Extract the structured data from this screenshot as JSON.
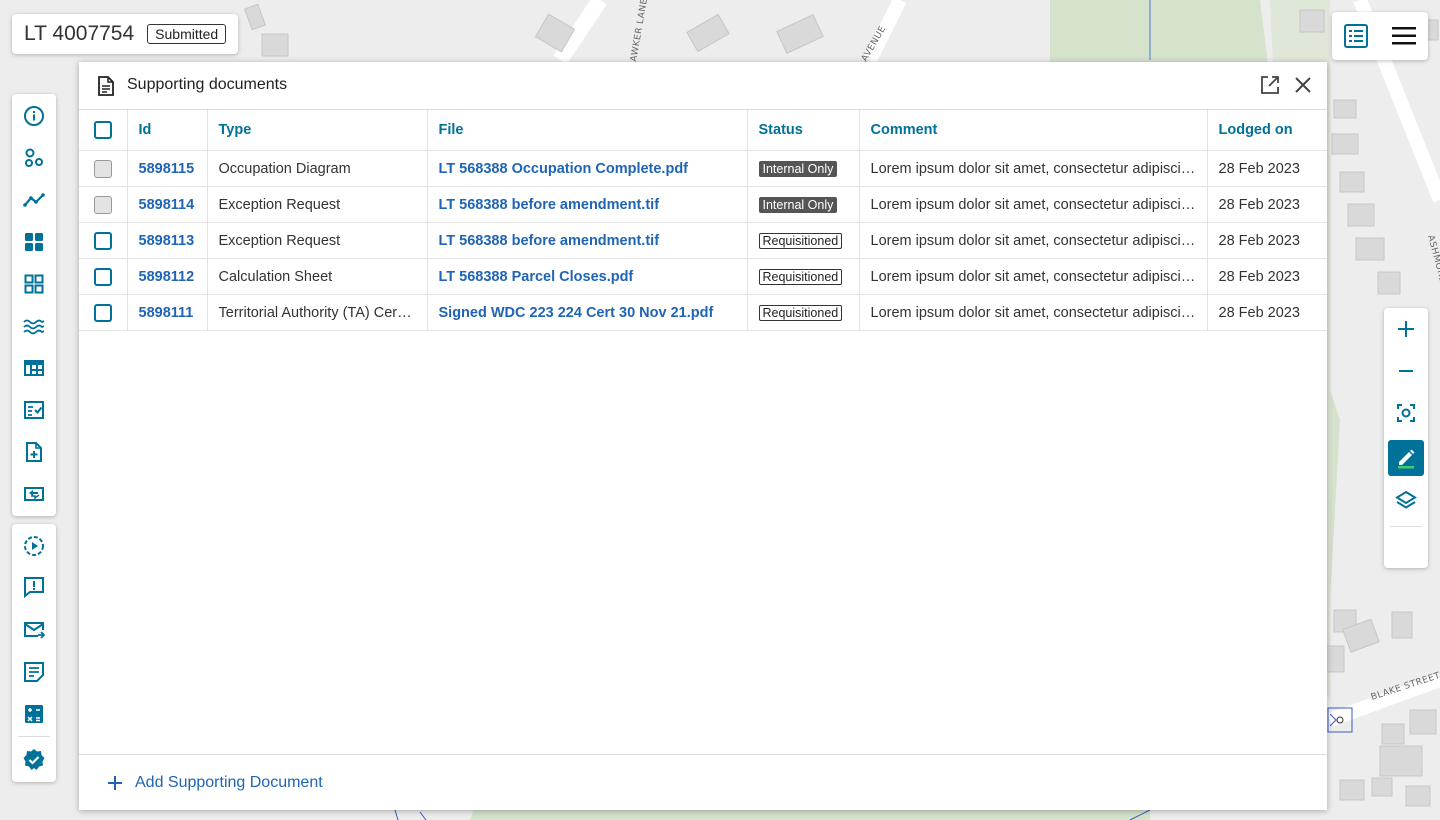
{
  "header": {
    "plan_id": "LT 4007754",
    "status_badge": "Submitted"
  },
  "map": {
    "street_labels": [
      "AWKER LANE",
      "AVENUE",
      "ASHMORE ST",
      "BLAKE STREET"
    ]
  },
  "panel": {
    "title": "Supporting documents",
    "columns": [
      "Id",
      "Type",
      "File",
      "Status",
      "Comment",
      "Lodged on"
    ],
    "rows": [
      {
        "id": "5898115",
        "type": "Occupation Diagram",
        "file": "LT 568388 Occupation Complete.pdf",
        "status": "Internal Only",
        "comment": "Lorem ipsum dolor sit amet, consectetur adipiscing elit",
        "lodged": "28 Feb 2023"
      },
      {
        "id": "5898114",
        "type": "Exception Request",
        "file": "LT 568388 before amendment.tif",
        "status": "Internal Only",
        "comment": "Lorem ipsum dolor sit amet, consectetur adipiscing elit",
        "lodged": "28 Feb 2023"
      },
      {
        "id": "5898113",
        "type": "Exception Request",
        "file": "LT 568388 before amendment.tif",
        "status": "Requisitioned",
        "comment": "Lorem ipsum dolor sit amet, consectetur adipiscing elit",
        "lodged": "28 Feb 2023"
      },
      {
        "id": "5898112",
        "type": "Calculation Sheet",
        "file": "LT 568388 Parcel Closes.pdf",
        "status": "Requisitioned",
        "comment": "Lorem ipsum dolor sit amet, consectetur adipiscing elit",
        "lodged": "28 Feb 2023"
      },
      {
        "id": "5898111",
        "type": "Territorial Authority (TA) Certificate",
        "file": "Signed WDC 223 224 Cert 30 Nov 21.pdf",
        "status": "Requisitioned",
        "comment": "Lorem ipsum dolor sit amet, consectetur adipiscing elit",
        "lodged": "28 Feb 2023"
      }
    ],
    "footer_action": "Add Supporting Document"
  },
  "icons": {
    "left_toolbar": [
      "info-icon",
      "parcels-icon",
      "traverse-icon",
      "grid-icon",
      "grid-outline-icon",
      "water-icon",
      "table-icon",
      "checklist-icon",
      "file-add-icon",
      "swap-icon",
      "play-circle-icon",
      "feedback-icon",
      "mail-icon",
      "notes-icon",
      "calculator-icon",
      "verified-badge-icon"
    ],
    "map_tools": [
      "zoom-in-icon",
      "zoom-out-icon",
      "zoom-to-extent-icon",
      "edit-icon",
      "layers-icon"
    ]
  },
  "colors": {
    "primary": "#007198",
    "link": "#1f64b5",
    "internal_badge": "#555555"
  }
}
